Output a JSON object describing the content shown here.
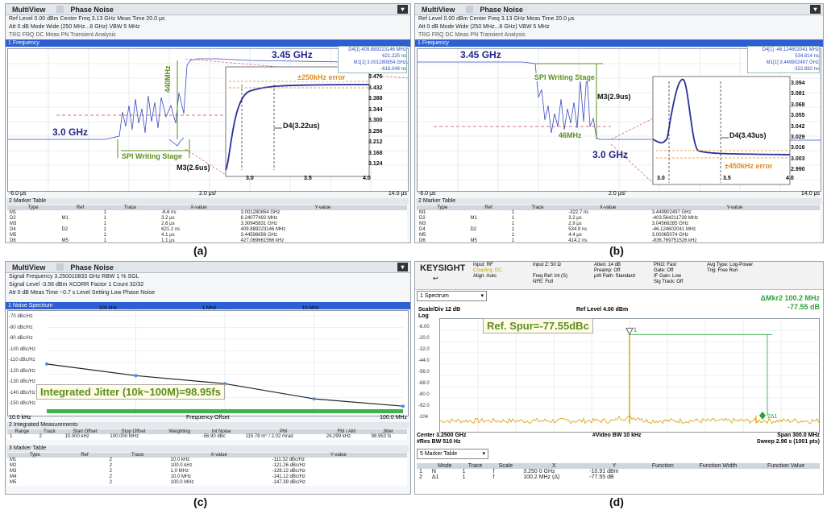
{
  "captions": {
    "a": "(a)",
    "b": "(b)",
    "c": "(c)",
    "d": "(d)"
  },
  "panel_a": {
    "tabs": [
      "MultiView",
      "Phase Noise"
    ],
    "info": [
      "Ref Level 0.00 dBm   Center Freq 3.13 GHz   Meas Time 20.0 μs",
      "Att 0 dB   Mode Wide (250 MHz...8 GHz)   VBW 5 MHz",
      "TRG FRQ DC                                                    Meas PN Transient Analysis"
    ],
    "trace_title": "1 Frequency",
    "markers_right": [
      "D4[1] 409.889223146 MHz",
      "621.225 ns",
      "M1[1] 3.001280854 GHz",
      "-616.048 ns"
    ],
    "inset_ticks": [
      "3.476",
      "3.432",
      "3.388",
      "3.344",
      "3.300",
      "3.256",
      "3.212",
      "3.168",
      "3.124"
    ],
    "inset_xticks": [
      "3.0",
      "3.5",
      "4.0"
    ],
    "annotations": {
      "f_high": "3.45 GHz",
      "f_low": "3.0 GHz",
      "step": "440MHz",
      "error": "±250kHz error",
      "d4": "D4(3.22us)",
      "m3": "M3(2.6us)",
      "spi": "SPI Writing Stage"
    },
    "x_left": "-6.0 μs",
    "x_mid": "2.0 μs/",
    "x_right": "14.0 μs",
    "marker_table_title": "2 Marker Table",
    "marker_table": {
      "headers": [
        "Type",
        "Ref",
        "Trace",
        "X-value",
        "Y-value"
      ],
      "rows": [
        [
          "M1",
          "",
          "1",
          "-6.6 ns",
          "3.001280854 GHz"
        ],
        [
          "D2",
          "M1",
          "1",
          "3.2 μs",
          "6.24077492 MHz"
        ],
        [
          "M3",
          "",
          "1",
          "2.6 μs",
          "3.30945831 GHz"
        ],
        [
          "D4",
          "D2",
          "1",
          "621.2 ns",
          "409.889223146 MHz"
        ],
        [
          "M5",
          "",
          "1",
          "4.1 μs",
          "3.44596656 GHz"
        ],
        [
          "D6",
          "M5",
          "1",
          "1.1 μs",
          "427.069661566 kHz"
        ]
      ]
    }
  },
  "panel_b": {
    "tabs": [
      "MultiView",
      "Phase Noise"
    ],
    "info": [
      "Ref Level 0.00 dBm   Center Freq 3.13 GHz   Meas Time 20.0 μs",
      "Att 0 dB   Mode Wide (250 MHz...8 GHz)   VBW 5 MHz",
      "TRG FRQ DC                                                    Meas PN Transient Analysis"
    ],
    "trace_title": "1 Frequency",
    "markers_right": [
      "D4[1] -46.124602041 MHz",
      "534.814 ns",
      "M1[1] 3.449902497 GHz",
      "-322.692 ns"
    ],
    "inset_ticks": [
      "3.094",
      "3.081",
      "3.068",
      "3.055",
      "3.042",
      "3.029",
      "3.016",
      "3.003",
      "2.990"
    ],
    "inset_xticks": [
      "3.0",
      "3.5",
      "4.0"
    ],
    "annotations": {
      "f_high": "3.45 GHz",
      "f_low": "3.0 GHz",
      "step": "46MHz",
      "error": "±450kHz error",
      "d4": "D4(3.43us)",
      "m3": "M3(2.9us)",
      "spi": "SPI Writing Stage"
    },
    "x_left": "-6.0 μs",
    "x_mid": "2.0 μs/",
    "x_right": "14.0 μs",
    "marker_table_title": "2 Marker Table",
    "marker_table": {
      "headers": [
        "Type",
        "Ref",
        "Trace",
        "X-value",
        "Y-value"
      ],
      "rows": [
        [
          "M1",
          "",
          "1",
          "-322.7 ns",
          "3.449902497 GHz"
        ],
        [
          "D2",
          "M1",
          "1",
          "3.2 μs",
          "-403.564211739 MHz"
        ],
        [
          "M3",
          "",
          "1",
          "2.9 μs",
          "3.04568285 GHz"
        ],
        [
          "D4",
          "D2",
          "1",
          "534.9 ns",
          "-46.124602041 MHz"
        ],
        [
          "M5",
          "",
          "1",
          "4.4 μs",
          "3.00065074 GHz"
        ],
        [
          "D6",
          "M5",
          "1",
          "414.2 ns",
          "-836.769751526 kHz"
        ]
      ]
    }
  },
  "panel_c": {
    "tabs": [
      "MultiView",
      "Phase Noise"
    ],
    "info": [
      "Signal Frequency 3.250010833 GHz   RBW 1 %   SGL",
      "Signal Level -3.56 dBm   XCORR Factor 1   Count 32/32",
      "Att 0 dB   Meas Time ~0.7 s   Level Setting Low   Phase Noise"
    ],
    "trace_title": "1 Noise Spectrum",
    "y_ticks": [
      "-70 dBc/Hz",
      "-80 dBc/Hz",
      "-90 dBc/Hz",
      "-100 dBc/Hz",
      "-110 dBc/Hz",
      "-120 dBc/Hz",
      "-130 dBc/Hz",
      "-140 dBc/Hz",
      "-150 dBc/Hz"
    ],
    "x_ticks": [
      "100 kHz",
      "1 MHz",
      "10 MHz"
    ],
    "x_left": "10.0 kHz",
    "x_mid": "Frequency Offset",
    "x_right": "100.0 MHz",
    "jitter_label": "Integrated Jitter (10k~100M)=98.95fs",
    "integ_title": "2 Integrated Measurements",
    "integ_headers": [
      "Range",
      "Track",
      "Start Offset",
      "Stop Offset",
      "Weighting",
      "Int Noise",
      "PM",
      "FM / AM",
      "Jitter"
    ],
    "integ_row": [
      "1",
      "2",
      "10.000 kHz",
      "100.000 MHz",
      "",
      "-56.90 dBc",
      "115.78 m° / 2.02 mrad",
      "24.299 kHz",
      "98.953 fs"
    ],
    "marker_table_title": "3 Marker Table",
    "marker_table": {
      "headers": [
        "Type",
        "Ref",
        "Trace",
        "X-value",
        "Y-value"
      ],
      "rows": [
        [
          "M1",
          "",
          "2",
          "10.0 kHz",
          "-111.32 dBc/Hz"
        ],
        [
          "M2",
          "",
          "2",
          "100.0 kHz",
          "-121.26 dBc/Hz"
        ],
        [
          "M3",
          "",
          "2",
          "1.0 MHz",
          "-128.12 dBc/Hz"
        ],
        [
          "M4",
          "",
          "2",
          "10.0 MHz",
          "-141.12 dBc/Hz"
        ],
        [
          "M5",
          "",
          "2",
          "100.0 MHz",
          "-147.39 dBc/Hz"
        ]
      ]
    },
    "chart_data": {
      "type": "line",
      "xlabel": "Frequency Offset",
      "x_scale": "log",
      "xlim": [
        10000,
        100000000
      ],
      "ylim": [
        -150,
        -70
      ],
      "series": [
        {
          "x": [
            10000,
            100000,
            1000000,
            10000000,
            100000000
          ],
          "y": [
            -111.32,
            -121.26,
            -128.12,
            -141.12,
            -147.39
          ]
        }
      ]
    }
  },
  "panel_d": {
    "brand": "KEYSIGHT",
    "info_cols": [
      [
        "Input: RF",
        "Coupling: DC",
        "Align: Auto"
      ],
      [
        "Input Z: 50 Ω",
        "",
        "Freq Ref: Int (S)",
        "NFE: Full"
      ],
      [
        "Atten: 14 dB",
        "Preamp: Off",
        "μW Path: Standard"
      ],
      [
        "PNO: Fast",
        "Gate: Off",
        "IF Gain: Low",
        "Sig Track: Off"
      ],
      [
        "Avg Type: Log-Power",
        "Trig: Free Run"
      ]
    ],
    "spectrum_label": "1 Spectrum",
    "scale": "Scale/Div 12 dB",
    "ref_level": "Ref Level 4.00 dBm",
    "log": "Log",
    "y_ticks": [
      "-8.00",
      "-20.0",
      "-32.0",
      "-44.0",
      "-56.0",
      "-68.0",
      "-80.0",
      "-92.0",
      "-104"
    ],
    "mkr_label": "ΔMkr2 100.2 MHz",
    "mkr_value": "-77.55 dB",
    "spur_label": "Ref. Spur=-77.55dBc",
    "center": "Center 3.2500 GHz",
    "res_bw": "#Res BW 510 Hz",
    "video_bw": "#Video BW 10 kHz",
    "span": "Span 300.0 MHz",
    "sweep": "Sweep 2.96 s (1001 pts)",
    "marker_table_label": "5 Marker Table",
    "marker_table": {
      "headers": [
        "",
        "Mode",
        "Trace",
        "Scale",
        "X",
        "Y",
        "Function",
        "Function Width",
        "Function Value"
      ],
      "rows": [
        [
          "1",
          "N",
          "1",
          "f",
          "3.250 0 GHz",
          "-10.91 dBm",
          "",
          "",
          ""
        ],
        [
          "2",
          "Δ1",
          "1",
          "f",
          "100.2 MHz (Δ)",
          "-77.55 dB",
          "",
          "",
          ""
        ]
      ]
    },
    "marker1": "1",
    "marker2": "2Δ1",
    "chart_data": {
      "type": "line",
      "xlabel": "",
      "ylabel": "",
      "xlim": [
        3.1,
        3.4
      ],
      "ylim": [
        -104,
        4
      ],
      "series": [
        {
          "x": [
            3.25,
            3.3502
          ],
          "y": [
            -10.91,
            -88.46
          ]
        }
      ]
    }
  }
}
